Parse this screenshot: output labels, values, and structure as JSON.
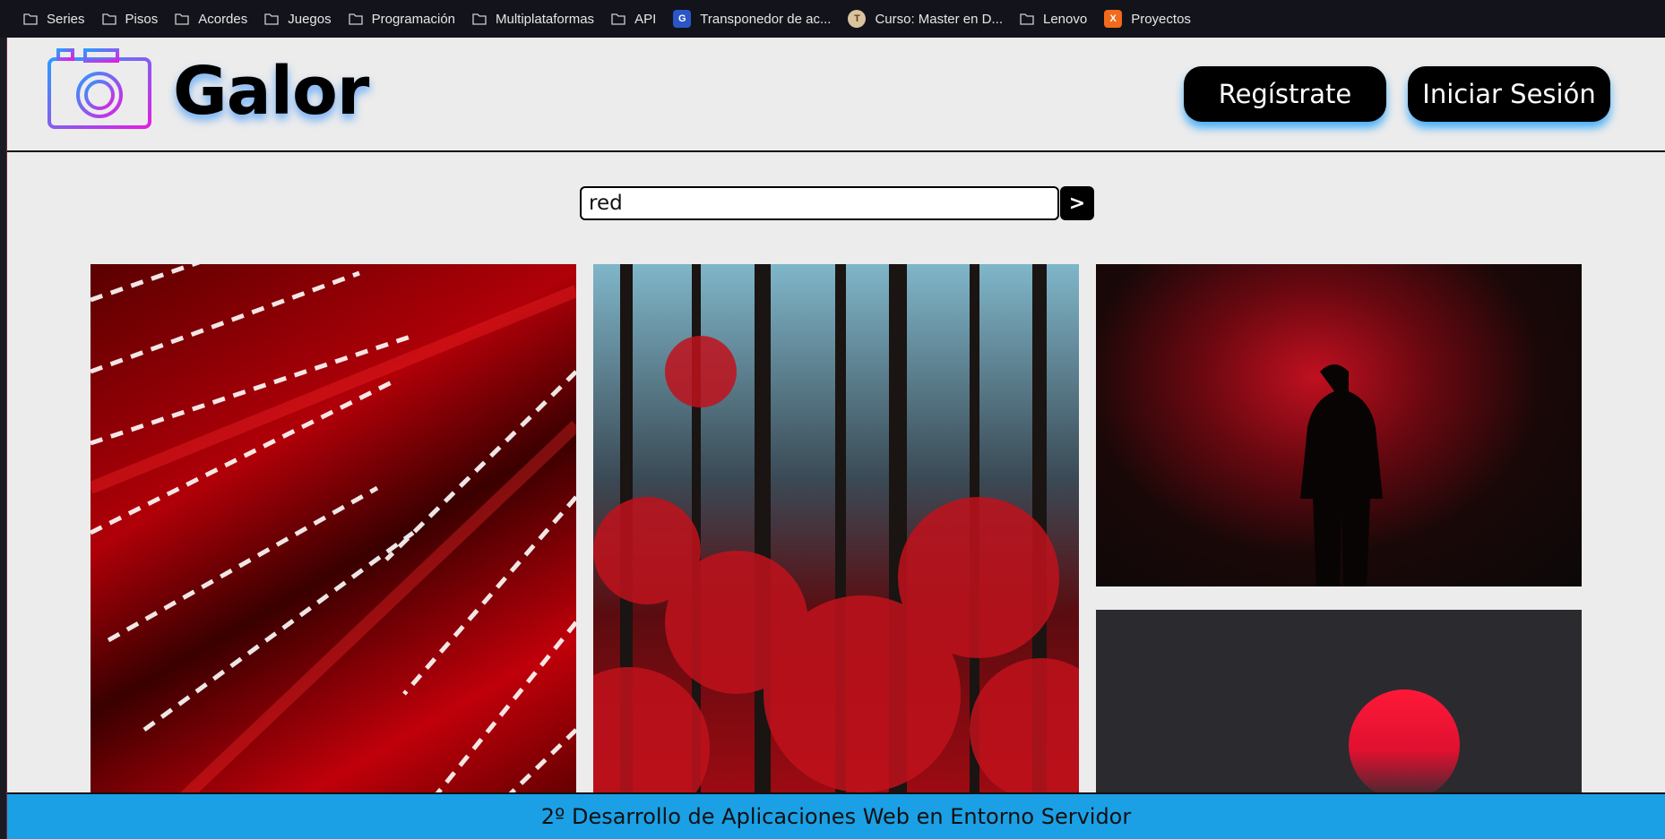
{
  "bookmarks": [
    {
      "label": "Series",
      "icon": "folder-icon"
    },
    {
      "label": "Pisos",
      "icon": "folder-icon"
    },
    {
      "label": "Acordes",
      "icon": "folder-icon"
    },
    {
      "label": "Juegos",
      "icon": "folder-icon"
    },
    {
      "label": "Programación",
      "icon": "folder-icon"
    },
    {
      "label": "Multiplataformas",
      "icon": "folder-icon"
    },
    {
      "label": "API",
      "icon": "folder-icon"
    },
    {
      "label": "Transponedor de ac...",
      "icon": "site-icon"
    },
    {
      "label": "Curso: Master en D...",
      "icon": "site-icon"
    },
    {
      "label": "Lenovo",
      "icon": "folder-icon"
    },
    {
      "label": "Proyectos",
      "icon": "site-icon"
    }
  ],
  "header": {
    "logo_text": "Galor",
    "register_label": "Regístrate",
    "login_label": "Iniciar Sesión"
  },
  "search": {
    "value": "red",
    "button_label": ">"
  },
  "footer": {
    "text": "2º Desarrollo de Aplicaciones Web en Entorno Servidor"
  },
  "colors": {
    "accent": "#1ba0e6",
    "button_bg": "#000000",
    "page_bg": "#ececec"
  }
}
